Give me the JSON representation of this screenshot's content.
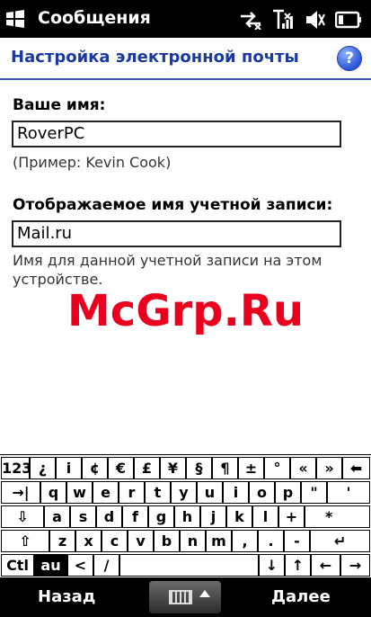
{
  "status_bar": {
    "title": "Сообщения"
  },
  "header": {
    "title": "Настройка электронной почты",
    "help_label": "?"
  },
  "form": {
    "name_label": "Ваше имя:",
    "name_value": "RoverPC",
    "name_hint": "(Пример: Kevin Cook)",
    "account_label": "Отображаемое имя учетной записи:",
    "account_value": "Mail.ru",
    "account_hint": "Имя для данной учетной записи на этом устройстве."
  },
  "watermark": "McGrp.Ru",
  "keyboard": {
    "row1": [
      "123",
      "¿",
      "i",
      "¢",
      "€",
      "£",
      "¥",
      "§",
      "¶",
      "±",
      "°",
      "«",
      "»",
      "⬅"
    ],
    "row2": [
      "→|",
      "q",
      "w",
      "e",
      "r",
      "t",
      "y",
      "u",
      "i",
      "o",
      "p",
      "\"",
      "'"
    ],
    "row3": [
      "⇩",
      "a",
      "s",
      "d",
      "f",
      "g",
      "h",
      "j",
      "k",
      "l",
      "+",
      "*"
    ],
    "row4": [
      "⇧",
      "z",
      "x",
      "c",
      "v",
      "b",
      "n",
      "m",
      ",",
      ".",
      "-",
      "↵"
    ],
    "row5": [
      "Ctl",
      "au",
      "<",
      "/",
      "",
      "↓",
      "↑",
      "←",
      "→"
    ]
  },
  "softkeys": {
    "left": "Назад",
    "right": "Далее"
  },
  "icons": [
    "windows-logo-icon",
    "sync-icon",
    "signal-icon",
    "volume-icon",
    "battery-icon",
    "help-icon",
    "keyboard-icon"
  ]
}
